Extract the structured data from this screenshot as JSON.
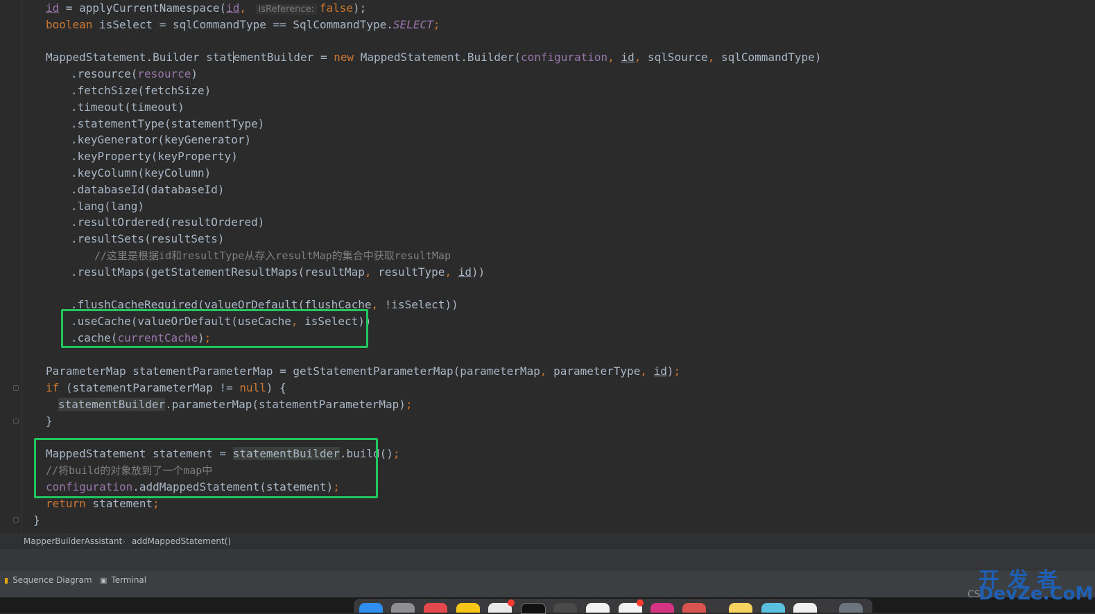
{
  "editor": {
    "lines": {
      "l1": {
        "id": "id",
        "eq": " = applyCurrentNamespace(",
        "arg": "id",
        "sep": ", ",
        "hint": "isReference:",
        "val": "false",
        "end": ");"
      },
      "l2": {
        "kw": "boolean",
        "rest": " isSelect = sqlCommandType == SqlCommandType.",
        "cst": "SELECT",
        "end": ";"
      },
      "l4": {
        "a": "MappedStatement.Builder ",
        "b": "stat",
        "c": "ementBuilder = ",
        "kw": "new",
        "d": " MappedStatement.Builder(",
        "f1": "configuration",
        "s1": ", ",
        "id": "id",
        "s2": ", ",
        "e": "sqlSource",
        "s3": ", ",
        "g": "sqlCommandType)"
      },
      "l5": {
        "a": ".resource(",
        "f": "resource",
        "b": ")"
      },
      "l6": ".fetchSize(fetchSize)",
      "l7": ".timeout(timeout)",
      "l8": ".statementType(statementType)",
      "l9": ".keyGenerator(keyGenerator)",
      "l10": ".keyProperty(keyProperty)",
      "l11": ".keyColumn(keyColumn)",
      "l12": ".databaseId(databaseId)",
      "l13": ".lang(lang)",
      "l14": ".resultOrdered(resultOrdered)",
      "l15": ".resultSets(resultSets)",
      "l16": "//这里是根据id和resultType从存入resultMap的集合中获取resultMap",
      "l17": {
        "a": ".resultMaps(getStatementResultMaps(resultMap",
        "s1": ", ",
        "b": "resultType",
        "s2": ", ",
        "id": "id",
        "c": "))"
      },
      "l18": {
        "a": ".flushCacheRequired(valueOrDefault(flushCache",
        "s": ", ",
        "b": "!isSelect))"
      },
      "l19": {
        "a": ".useCache(valueOrDefault(useCache",
        "s": ", ",
        "b": "isSelect))"
      },
      "l20": {
        "a": ".cache(",
        "f": "currentCache",
        "b": ")",
        "s": ";"
      },
      "l22": {
        "a": "ParameterMap statementParameterMap = getStatementParameterMap(parameterMap",
        "s1": ", ",
        "b": "parameterType",
        "s2": ", ",
        "id": "id",
        "c": ")",
        "s3": ";"
      },
      "l23": {
        "kw": "if",
        "a": " (statementParameterMap != ",
        "nl": "null",
        "b": ") {"
      },
      "l24": {
        "hl": "statementBuilder",
        "a": ".parameterMap(statementParameterMap)",
        "s": ";"
      },
      "l25": "}",
      "l27": {
        "a": "MappedStatement statement = ",
        "hl": "statementBuilder",
        "b": ".build()",
        "s": ";"
      },
      "l28": "//将build的对象放到了一个map中",
      "l29": {
        "f": "configuration",
        "a": ".addMappedStatement(statement)",
        "s": ";"
      },
      "l30": {
        "kw": "return",
        "a": " statement",
        "s": ";"
      },
      "l31": "}"
    }
  },
  "breadcrumb": {
    "class_name": "MapperBuilderAssistant",
    "method_name": "addMappedStatement()"
  },
  "toolwindows": {
    "sequence_diagram": "Sequence Diagram",
    "terminal": "Terminal"
  },
  "dock": {
    "apps": [
      "finder",
      "launchpad",
      "app-red",
      "notes",
      "chrome",
      "terminal",
      "app-dark",
      "safari",
      "mail",
      "app-pink",
      "app-red2",
      "app-yellow",
      "app-blue",
      "app-white",
      "app-gray"
    ],
    "badges": [
      "1",
      "3"
    ]
  },
  "watermark": {
    "cn": "开发者",
    "en": "DevZe.CoM",
    "prefix": "CS"
  },
  "colors": {
    "highlight_box": "#22c55e",
    "background": "#2b2b2b",
    "keyword": "#cc7832",
    "field": "#9876aa",
    "comment": "#808080"
  }
}
